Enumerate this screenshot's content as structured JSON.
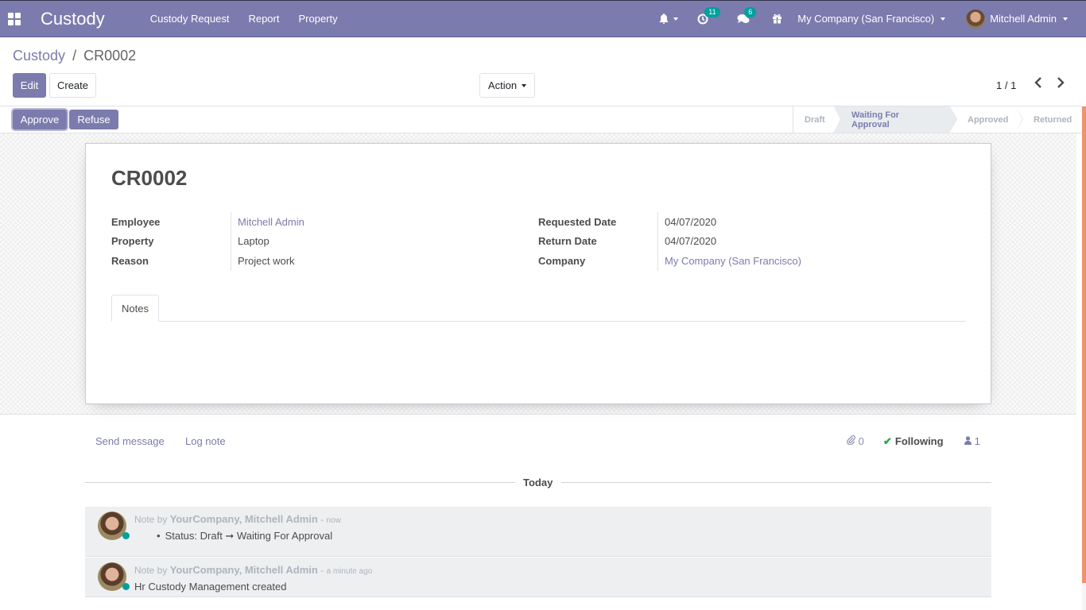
{
  "navbar": {
    "app_name": "Custody",
    "menu": [
      "Custody Request",
      "Report",
      "Property"
    ],
    "activity_count": "11",
    "message_count": "6",
    "company": "My Company (San Francisco)",
    "user": "Mitchell Admin"
  },
  "breadcrumb": {
    "parent": "Custody",
    "separator": "/",
    "current": "CR0002"
  },
  "buttons": {
    "edit": "Edit",
    "create": "Create",
    "action": "Action",
    "approve": "Approve",
    "refuse": "Refuse"
  },
  "pager": {
    "value": "1 / 1",
    "prev": "‹",
    "next": "›"
  },
  "stages": [
    {
      "label": "Draft",
      "current": false
    },
    {
      "label": "Waiting For Approval",
      "current": true
    },
    {
      "label": "Approved",
      "current": false
    },
    {
      "label": "Returned",
      "current": false
    }
  ],
  "record": {
    "title": "CR0002",
    "left_fields": [
      {
        "label": "Employee",
        "value": "Mitchell Admin"
      },
      {
        "label": "Property",
        "value": "Laptop"
      },
      {
        "label": "Reason",
        "value": "Project work"
      }
    ],
    "right_fields": [
      {
        "label": "Requested Date",
        "value": "04/07/2020"
      },
      {
        "label": "Return Date",
        "value": "04/07/2020"
      },
      {
        "label": "Company",
        "value": "My Company (San Francisco)"
      }
    ],
    "tabs": [
      "Notes"
    ]
  },
  "chatter": {
    "send_message": "Send message",
    "log_note": "Log note",
    "attachments": "0",
    "following": "Following",
    "followers": "1",
    "date_separator": "Today",
    "messages": [
      {
        "prefix": "Note by",
        "author": "YourCompany, Mitchell Admin",
        "date": "now",
        "body": "Status: Draft ➞ Waiting For Approval"
      },
      {
        "prefix": "Note by",
        "author": "YourCompany, Mitchell Admin",
        "date": "a minute ago",
        "body": "Hr Custody Management created"
      }
    ]
  },
  "colors": {
    "brand": "#7c7bad",
    "presence": "#00a09d",
    "check": "#28a745",
    "scrollbar": "#f0936a"
  }
}
